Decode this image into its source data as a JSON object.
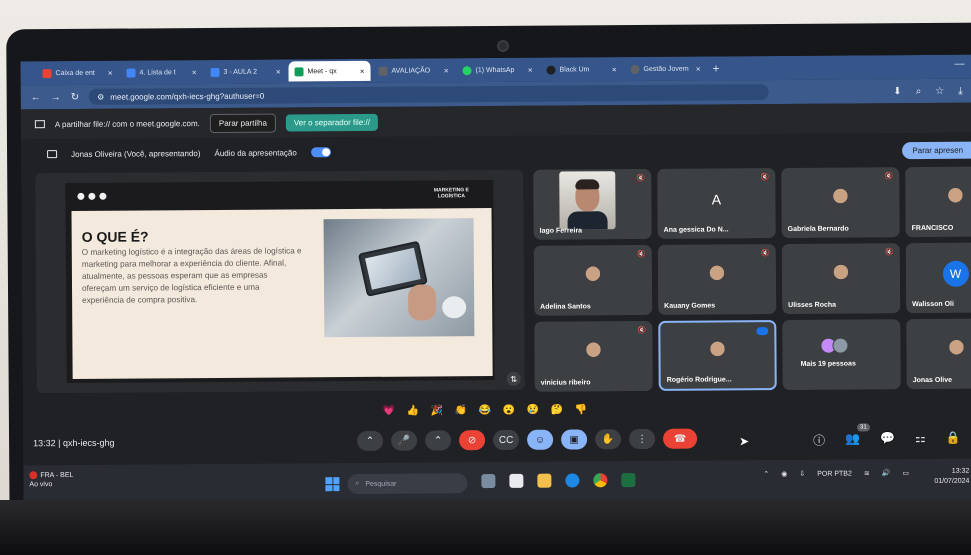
{
  "browser": {
    "tabs": [
      {
        "label": "Caixa de ent",
        "color": "#ea4335",
        "active": false
      },
      {
        "label": "4. Lista de t",
        "color": "#4285f4",
        "active": false
      },
      {
        "label": "3 - AULA 2",
        "color": "#4285f4",
        "active": false
      },
      {
        "label": "Meet - qx",
        "color": "#0f9d58",
        "active": true
      },
      {
        "label": "AVALIAÇÃO",
        "color": "#5f6368",
        "active": false
      },
      {
        "label": "(1) WhatsAp",
        "color": "#25d366",
        "active": false
      },
      {
        "label": "Black Um",
        "color": "#202124",
        "active": false
      },
      {
        "label": "Gestão Jovem",
        "color": "#5f6368",
        "active": false
      }
    ],
    "url": "meet.google.com/qxh-iecs-ghg?authuser=0"
  },
  "share_bar": {
    "text": "A partilhar file:// com o meet.google.com.",
    "stop_label": "Parar partilha",
    "see_tab_label": "Ver o separador file://"
  },
  "present_bar": {
    "presenter": "Jonas Oliveira (Você, apresentando)",
    "audio_label": "Áudio da apresentação",
    "stop_label": "Parar apresen"
  },
  "slide": {
    "tag": "MARKETING E LOGÍSTICA",
    "title": "O QUE É?",
    "body": "O marketing logístico é a integração das áreas de logística e marketing para melhorar a experiência do cliente. Afinal, atualmente, as pessoas esperam que as empresas ofereçam um serviço de logística eficiente e uma experiência de compra positiva."
  },
  "participants": [
    {
      "name": "Iago Ferreira",
      "kind": "camera"
    },
    {
      "name": "Ana gessica Do N...",
      "kind": "letter",
      "initial": "A"
    },
    {
      "name": "Gabriela Bernardo",
      "kind": "photo"
    },
    {
      "name": "FRANCISCO",
      "kind": "photo"
    },
    {
      "name": "Adelina Santos",
      "kind": "photo"
    },
    {
      "name": "Kauany Gomes",
      "kind": "photo"
    },
    {
      "name": "Ulisses Rocha",
      "kind": "photo"
    },
    {
      "name": "Walisson Oli",
      "kind": "letter-blue",
      "initial": "W"
    },
    {
      "name": "vinicius ribeiro",
      "kind": "photo"
    },
    {
      "name": "Rogério Rodrigue...",
      "kind": "photo"
    },
    {
      "name": "Mais 19 pessoas",
      "kind": "more"
    },
    {
      "name": "Jonas Olive",
      "kind": "photo"
    }
  ],
  "meeting": {
    "time": "13:32",
    "code": "qxh-iecs-ghg",
    "participant_count": "31"
  },
  "taskbar": {
    "live_line1": "FRA - BEL",
    "live_line2": "Ao vivo",
    "search_placeholder": "Pesquisar",
    "lang": "POR PTB2",
    "time": "13:32",
    "date": "01/07/2024"
  }
}
